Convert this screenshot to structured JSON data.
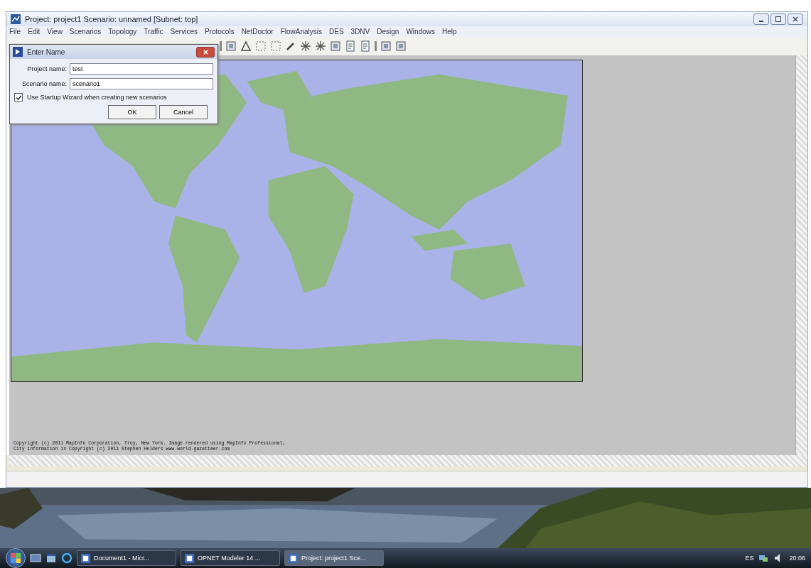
{
  "window": {
    "title": "Project: project1 Scenario: unnamed [Subnet: top]"
  },
  "menu": [
    "File",
    "Edit",
    "View",
    "Scenarios",
    "Topology",
    "Traffic",
    "Services",
    "Protocols",
    "NetDoctor",
    "FlowAnalysis",
    "DES",
    "3DNV",
    "Design",
    "Windows",
    "Help"
  ],
  "dialog": {
    "title": "Enter Name",
    "fields": [
      {
        "label": "Project name:",
        "value": "test"
      },
      {
        "label": "Scenario name:",
        "value": "scenario1"
      }
    ],
    "checkbox": {
      "label": "Use Startup Wizard when creating new scenarios",
      "checked": true
    },
    "buttons": [
      "OK",
      "Cancel"
    ]
  },
  "copyright": [
    "Copyright (c) 2011 MapInfo Corporation, Troy, New York. Image rendered using MapInfo Professional;",
    "City information is Copyright (c) 2011 Stephen Helders www.world-gazetteer.com"
  ],
  "taskbar": {
    "items": [
      {
        "label": "Document1 - Micr...",
        "selected": false
      },
      {
        "label": "OPNET Modeler 14 ...",
        "selected": false
      },
      {
        "label": "Project: project1 Sce...",
        "selected": true
      }
    ],
    "language": "ES",
    "clock": "20:06"
  }
}
